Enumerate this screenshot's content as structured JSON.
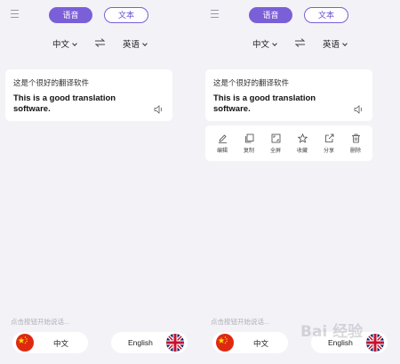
{
  "colors": {
    "accent": "#7b5fd8",
    "background": "#f3f2f7",
    "card": "#ffffff"
  },
  "panels": [
    {
      "tabs": {
        "voice": "语音",
        "text": "文本"
      },
      "languages": {
        "source": "中文",
        "target": "英语"
      },
      "card": {
        "source_text": "这是个很好的翻译软件",
        "translated_text": "This is a good translation software."
      },
      "show_actions": false,
      "hint": "点击按钮开始说话...",
      "buttons": {
        "chinese": "中文",
        "english": "English"
      }
    },
    {
      "tabs": {
        "voice": "语音",
        "text": "文本"
      },
      "languages": {
        "source": "中文",
        "target": "英语"
      },
      "card": {
        "source_text": "这是个很好的翻译软件",
        "translated_text": "This is a good translation software."
      },
      "show_actions": true,
      "actions": [
        {
          "icon": "edit-icon",
          "label": "编辑"
        },
        {
          "icon": "copy-icon",
          "label": "复制"
        },
        {
          "icon": "fullscreen-icon",
          "label": "全屏"
        },
        {
          "icon": "star-icon",
          "label": "收藏"
        },
        {
          "icon": "share-icon",
          "label": "分享"
        },
        {
          "icon": "delete-icon",
          "label": "删除"
        }
      ],
      "hint": "点击按钮开始说话...",
      "buttons": {
        "chinese": "中文",
        "english": "English"
      },
      "watermark": "Bai 经验"
    }
  ]
}
